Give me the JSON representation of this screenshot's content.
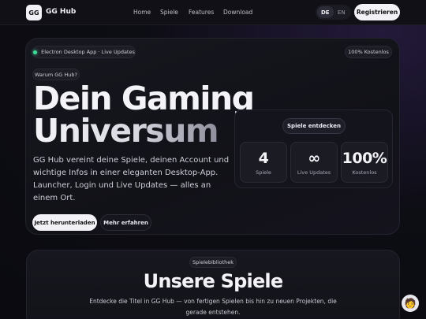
{
  "nav": {
    "logo": "GG",
    "brand": "GG Hub",
    "links": [
      "Home",
      "Spiele",
      "Features",
      "Download"
    ],
    "lang": [
      "DE",
      "EN"
    ],
    "register": "Registrieren"
  },
  "hero": {
    "badge": "Electron Desktop App · Live Updates",
    "free_badge": "100% Kostenlos",
    "why": "Warum GG Hub?",
    "headline_1": "Dein Gaming",
    "headline_2": "Universum",
    "description": "GG Hub vereint deine Spiele, deinen Account und wichtige Infos in einer eleganten Desktop-App. Launcher, Login und Live Updates — alles an einem Ort.",
    "download_btn": "Jetzt herunterladen",
    "more_btn": "Mehr erfahren"
  },
  "stats": {
    "discover_btn": "Spiele entdecken",
    "items": [
      {
        "value": "4",
        "label": "Spiele"
      },
      {
        "value": "∞",
        "label": "Live Updates"
      },
      {
        "value": "100%",
        "label": "Kostenlos"
      }
    ]
  },
  "library": {
    "tag": "Spielebibliothek",
    "title": "Unsere Spiele",
    "description": "Entdecke die Titel in GG Hub — von fertigen Spielen bis hin zu neuen Projekten, die gerade entstehen."
  },
  "avatar_icon": "person-icon"
}
